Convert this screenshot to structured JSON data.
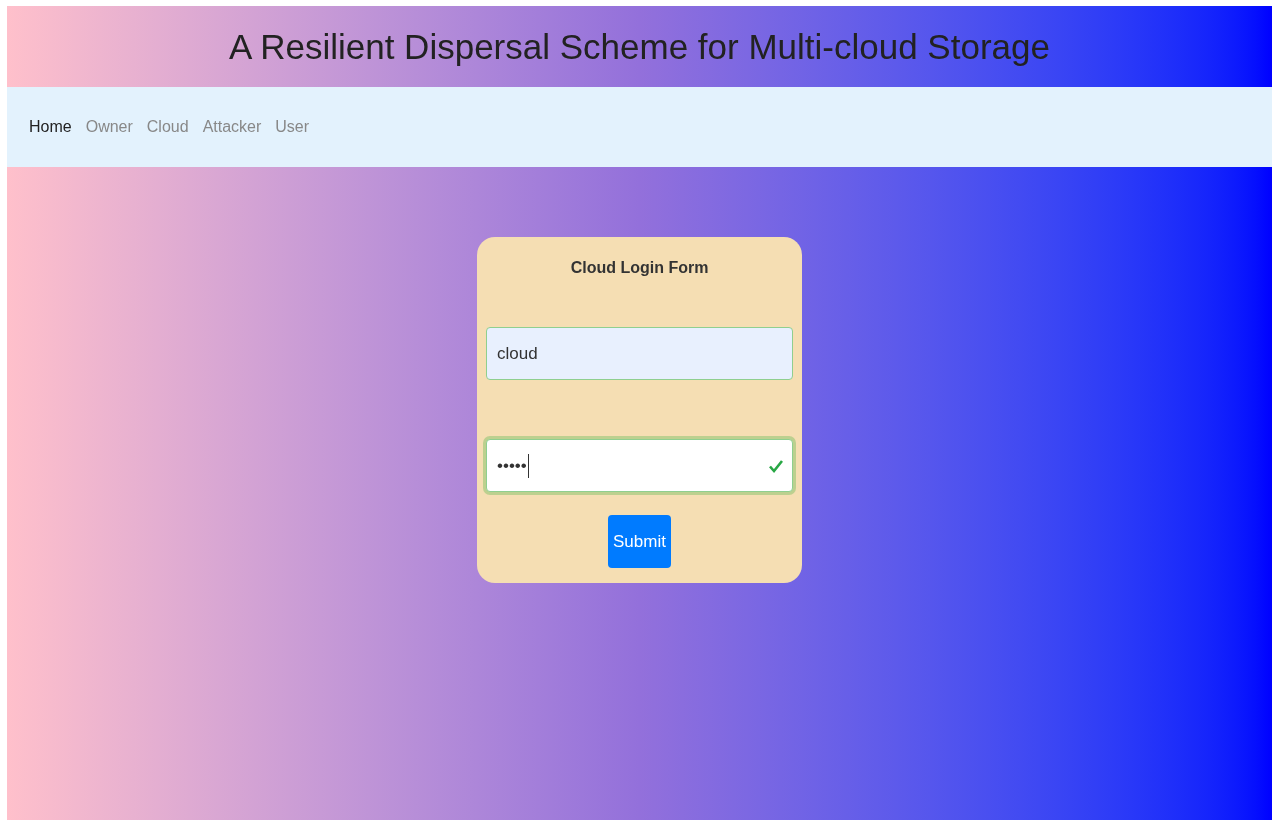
{
  "header": {
    "title": "A Resilient Dispersal Scheme for Multi-cloud Storage"
  },
  "nav": {
    "items": [
      {
        "label": "Home",
        "selected": true
      },
      {
        "label": "Owner",
        "selected": false
      },
      {
        "label": "Cloud",
        "selected": false
      },
      {
        "label": "Attacker",
        "selected": false
      },
      {
        "label": "User",
        "selected": false
      }
    ]
  },
  "form": {
    "title": "Cloud Login Form",
    "fields": [
      {
        "value": "cloud",
        "autofilled": true,
        "valid": false,
        "focused": false
      },
      {
        "value": "•••••",
        "autofilled": false,
        "valid": true,
        "focused": true
      }
    ],
    "button": "Submit"
  }
}
